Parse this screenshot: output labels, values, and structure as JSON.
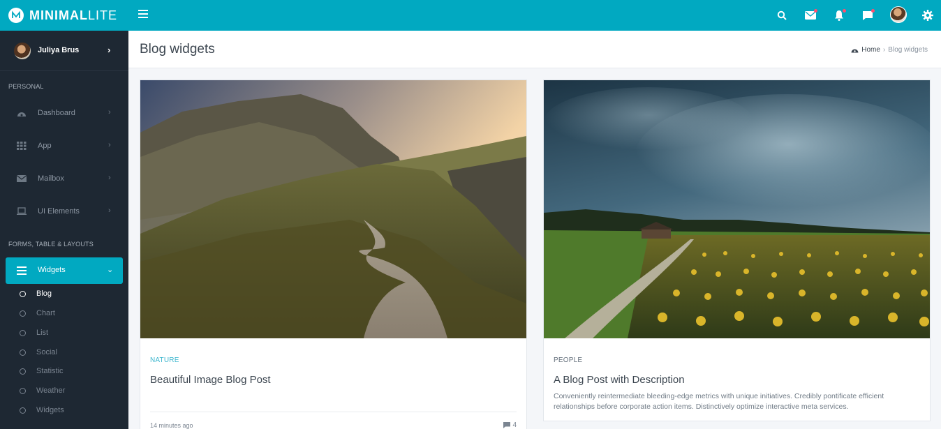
{
  "brand": {
    "name_bold": "MINIMAL",
    "name_light": "LITE"
  },
  "topbar": {
    "icons": [
      "search-icon",
      "mail-icon",
      "bell-icon",
      "chat-icon",
      "avatar",
      "gear-icon"
    ],
    "accent": "#01a9c1",
    "badge_color": "#ff4f70"
  },
  "sidebar": {
    "user_name": "Juliya Brus",
    "section_personal": "PERSONAL",
    "items": [
      {
        "label": "Dashboard",
        "icon": "dashboard-icon"
      },
      {
        "label": "App",
        "icon": "grid-icon"
      },
      {
        "label": "Mailbox",
        "icon": "envelope-icon"
      },
      {
        "label": "UI Elements",
        "icon": "laptop-icon"
      }
    ],
    "section_forms": "FORMS, TABLE & LAYOUTS",
    "active_item": {
      "label": "Widgets",
      "icon": "menu-icon"
    },
    "subitems": [
      "Blog",
      "Chart",
      "List",
      "Social",
      "Statistic",
      "Weather",
      "Widgets"
    ]
  },
  "header": {
    "title": "Blog widgets",
    "breadcrumb_home": "Home",
    "breadcrumb_current": "Blog widgets"
  },
  "cards": [
    {
      "category": "NATURE",
      "title": "Beautiful Image Blog Post",
      "time": "14 minutes ago",
      "comments": "4"
    },
    {
      "category": "PEOPLE",
      "title": "A Blog Post with Description",
      "description": "Conveniently reintermediate bleeding-edge metrics with unique initiatives. Credibly pontificate efficient relationships before corporate action items. Distinctively optimize interactive meta services."
    }
  ]
}
